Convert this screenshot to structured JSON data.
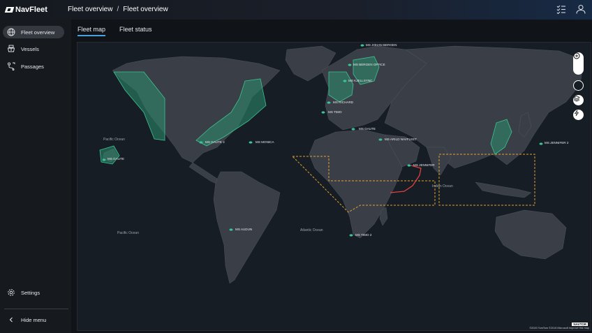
{
  "app": {
    "name": "NavFleet"
  },
  "breadcrumb": [
    "Fleet overview",
    "Fleet overview"
  ],
  "breadcrumb_separator": "/",
  "header_icons": [
    "checklist-icon",
    "user-icon"
  ],
  "sidebar": {
    "items": [
      {
        "label": "Fleet overview",
        "icon": "globe-icon",
        "active": true
      },
      {
        "label": "Vessels",
        "icon": "vessel-icon",
        "active": false
      },
      {
        "label": "Passages",
        "icon": "route-icon",
        "active": false
      }
    ],
    "settings": {
      "label": "Settings",
      "icon": "gear-icon"
    },
    "hide_menu": {
      "label": "Hide menu",
      "icon": "chevron-left-icon"
    }
  },
  "tabs": [
    {
      "label": "Fleet map",
      "active": true
    },
    {
      "label": "Fleet status",
      "active": false
    }
  ],
  "map": {
    "ships": [
      "MS JOHAN BERGEN",
      "MS BERGEN OFFICE",
      "MS KJELLSYNC",
      "MS RICHARD",
      "MS TIMO",
      "MS GAUTE",
      "MS ARILD NAVFLEET",
      "MS GAUTE 2",
      "MS MONICA",
      "MS GAUTE",
      "MS JENNIFER",
      "MS JENNIFER 2",
      "MS AUDUN",
      "MS TIMO 2"
    ],
    "oceans": [
      "Pacific Ocean",
      "Pacific Ocean",
      "Atlantic Ocean",
      "Indian Ocean"
    ],
    "controls": [
      "zoom-in-icon",
      "zoom-out-icon",
      "circle-icon",
      "layers-icon",
      "lightning-icon"
    ],
    "attribution": "©2020 TomTom ©2015 Microsoft Improve this map",
    "brand_tag": "NAVTOR",
    "colors": {
      "zone_fill": "#2b8f6e",
      "zone_stroke": "#3cc394",
      "route": "#e04040",
      "piracy_zone": "#e0a030",
      "land": "#3a3f47",
      "water": "#171d25"
    }
  }
}
